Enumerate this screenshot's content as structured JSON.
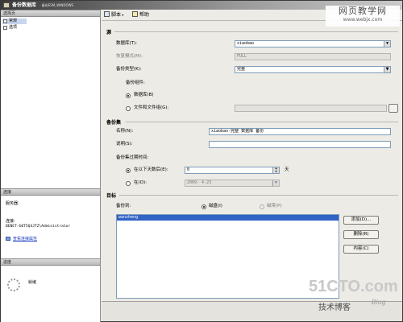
{
  "window": {
    "title": "备份数据库",
    "subtitle": "- 备份ESM_WINDOWS"
  },
  "left": {
    "pages_header": "选择页",
    "pages": [
      "常规",
      "选项"
    ],
    "connection_header": "连接",
    "server_label": "服务器:",
    "server_value": "",
    "connection_label": "连接:",
    "connection_value": "BENET-G0T5Q4JTZ\\Administrator",
    "view_connection_link": "查看连接属性",
    "progress_header": "进度",
    "progress_status": "就绪"
  },
  "toolbar": {
    "script_label": "脚本",
    "help_label": "帮助"
  },
  "source": {
    "section": "源",
    "database_label": "数据库(T):",
    "database_value": "xiaobao",
    "recovery_label": "恢复模式(M):",
    "recovery_value": "FULL",
    "backup_type_label": "备份类型(K):",
    "backup_type_value": "完整",
    "backup_component_label": "备份组件:",
    "component_db_label": "数据库(B)",
    "component_files_label": "文件和文件组(G):",
    "component_files_value": ""
  },
  "backup_set": {
    "section": "备份集",
    "name_label": "名称(N):",
    "name_value": "xiaobao-完整 数据库 备份",
    "description_label": "说明(S):",
    "description_value": "",
    "expire_label": "备份集过期时间:",
    "after_days_label": "在以下天数后(E):",
    "after_days_value": "0",
    "days_unit": "天",
    "on_date_label": "在(O):",
    "on_date_value": "2009- 4-23"
  },
  "destination": {
    "section": "目标",
    "backup_to_label": "备份到:",
    "disk_label": "磁盘(I)",
    "tape_label": "磁带(P)",
    "paths": [
      "wanzheng"
    ],
    "add_button": "添加(D)...",
    "remove_button": "删除(R)",
    "contents_button": "内容(C)"
  },
  "watermarks": {
    "top_a": "网页教学网",
    "top_b": "www.webjx.com",
    "bottom_a": "51CTO.com",
    "bottom_b": "技术博客",
    "bottom_c": "Blog"
  }
}
